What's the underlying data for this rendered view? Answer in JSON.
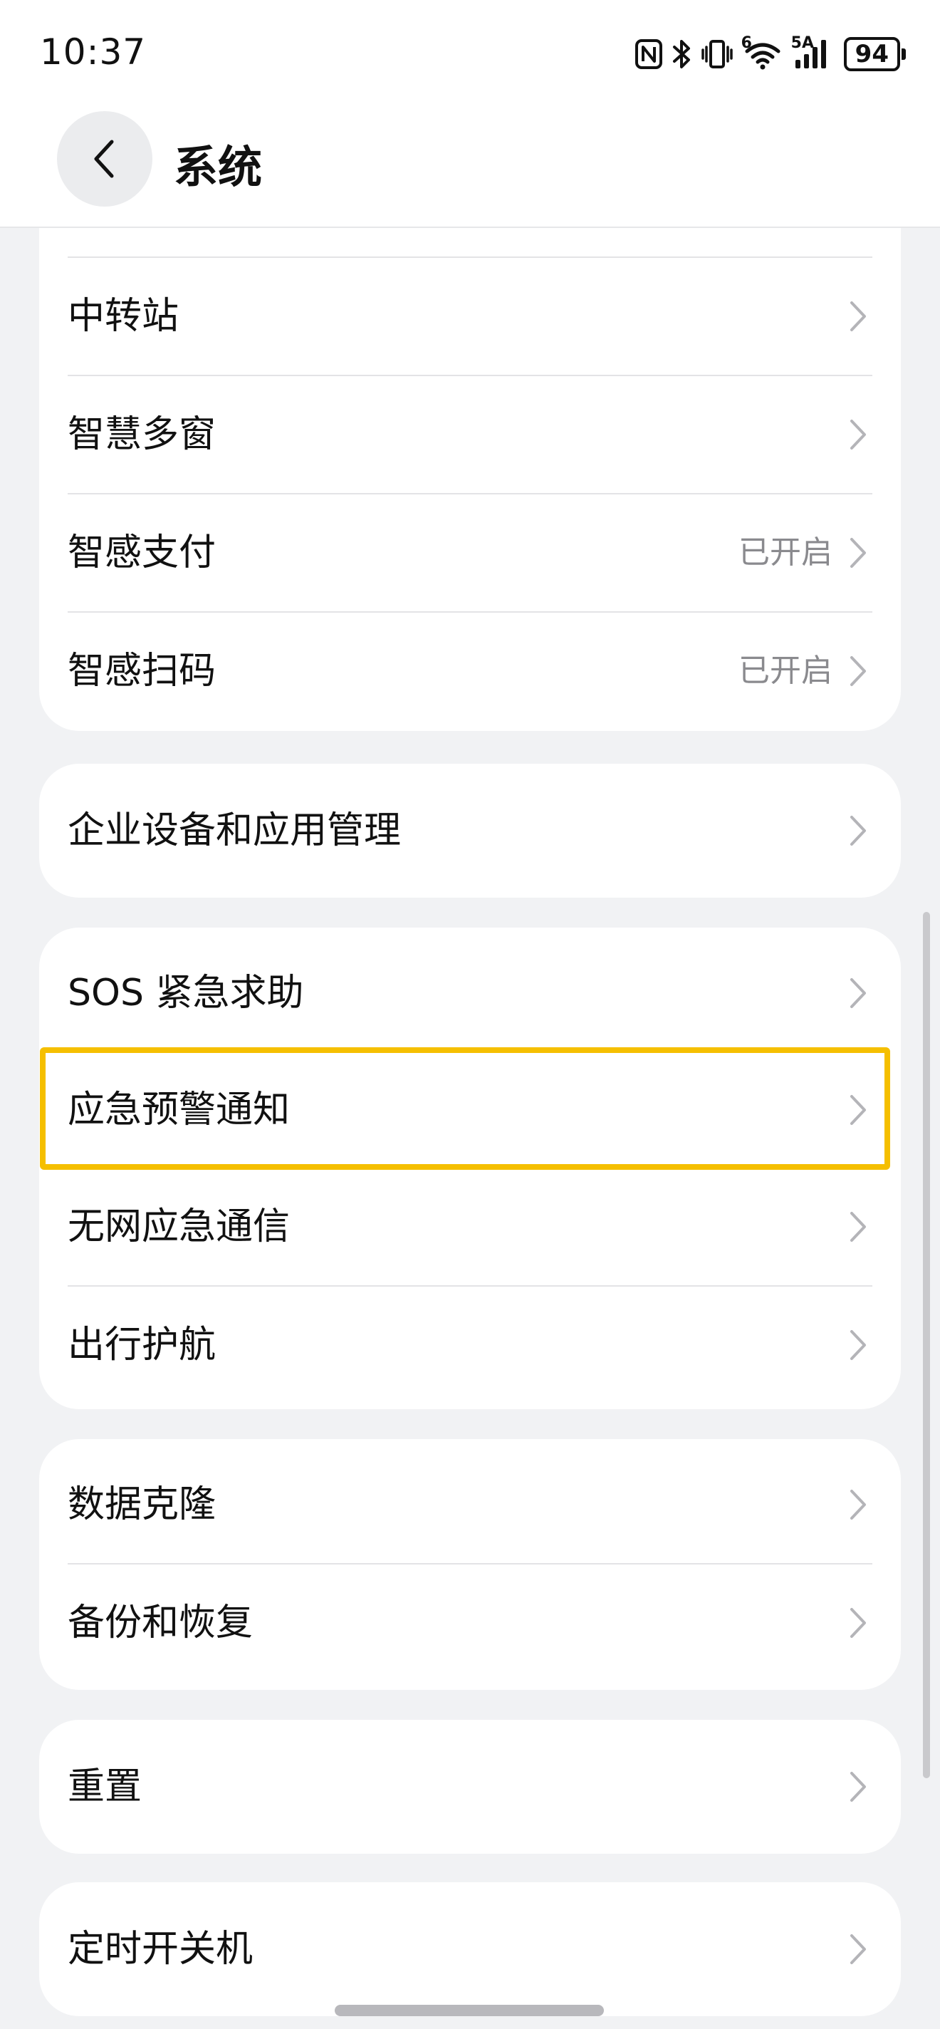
{
  "status_bar": {
    "time": "10:37",
    "battery": "94",
    "icons": [
      "nfc-icon",
      "bluetooth-icon",
      "vibrate-icon",
      "wifi-6-icon",
      "signal-5a-icon",
      "battery-icon"
    ],
    "wifi_badge": "6",
    "signal_badge": "5A"
  },
  "header": {
    "title": "系统",
    "back_icon": "chevron-left-icon"
  },
  "groups": [
    {
      "items": [
        {
          "label": "中转站",
          "value": ""
        },
        {
          "label": "智慧多窗",
          "value": ""
        },
        {
          "label": "智感支付",
          "value": "已开启"
        },
        {
          "label": "智感扫码",
          "value": "已开启"
        }
      ]
    },
    {
      "items": [
        {
          "label": "企业设备和应用管理",
          "value": ""
        }
      ]
    },
    {
      "items": [
        {
          "label": "SOS 紧急求助",
          "value": ""
        },
        {
          "label": "应急预警通知",
          "value": "",
          "highlighted": true
        },
        {
          "label": "无网应急通信",
          "value": ""
        },
        {
          "label": "出行护航",
          "value": ""
        }
      ]
    },
    {
      "items": [
        {
          "label": "数据克隆",
          "value": ""
        },
        {
          "label": "备份和恢复",
          "value": ""
        }
      ]
    },
    {
      "items": [
        {
          "label": "重置",
          "value": ""
        }
      ]
    },
    {
      "items": [
        {
          "label": "定时开关机",
          "value": ""
        }
      ]
    }
  ],
  "colors": {
    "background": "#f1f2f4",
    "card": "#ffffff",
    "highlight": "#f5bf00",
    "secondary_text": "#8a8a8e",
    "chevron": "#b4b4b8"
  }
}
